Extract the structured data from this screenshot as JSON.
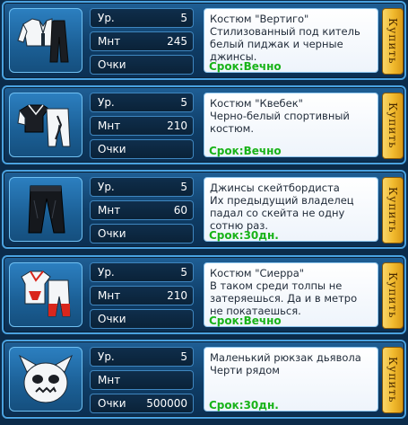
{
  "labels": {
    "level": "Ур.",
    "mnt": "Мнт",
    "points": "Очки",
    "buy": "Купить"
  },
  "items": [
    {
      "icon": "white-suit-icon",
      "level": "5",
      "mnt": "245",
      "points": "",
      "name": "Костюм \"Вертиго\"",
      "text": "Стилизованный под китель белый пиджак и черные джинсы.",
      "term": "Срок:Вечно"
    },
    {
      "icon": "sport-suit-icon",
      "level": "5",
      "mnt": "210",
      "points": "",
      "name": "Костюм \"Квебек\"",
      "text": "Черно-белый спортивный костюм.",
      "term": "Срок:Вечно"
    },
    {
      "icon": "jeans-icon",
      "level": "5",
      "mnt": "60",
      "points": "",
      "name": "Джинсы скейтбордиста",
      "text": "Их предыдущий владелец падал со скейта не одну сотню раз.",
      "term": "Срок:30дн."
    },
    {
      "icon": "red-white-suit-icon",
      "level": "5",
      "mnt": "210",
      "points": "",
      "name": "Костюм \"Сиерра\"",
      "text": "В таком среди толпы не затеряешься. Да и в метро не покатаешься.",
      "term": "Срок:Вечно"
    },
    {
      "icon": "devil-backpack-icon",
      "level": "5",
      "mnt": "",
      "points": "500000",
      "name": "Маленький рюкзак дьявола",
      "text": "Черти рядом",
      "term": "Срок:30дн."
    }
  ]
}
